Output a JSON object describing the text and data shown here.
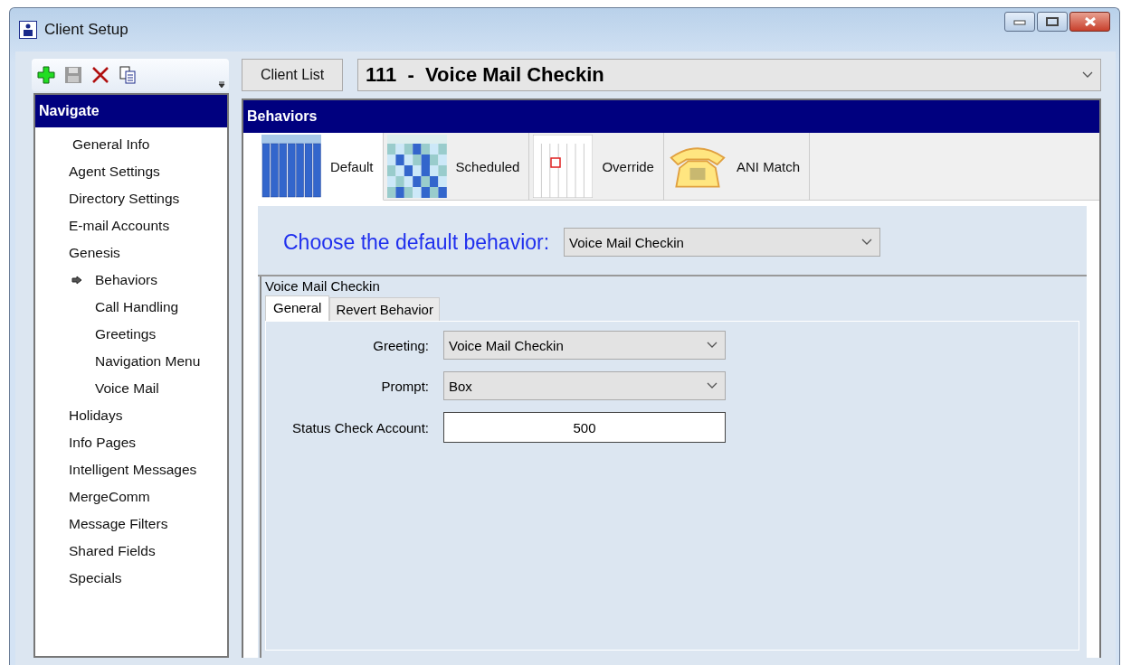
{
  "window": {
    "title": "Client Setup"
  },
  "client_list_button": "Client List",
  "client_selector": {
    "number": "111",
    "separator": "-",
    "name": "Voice Mail Checkin"
  },
  "navigate": {
    "title": "Navigate",
    "items": [
      {
        "label": "General Info"
      },
      {
        "label": "Agent Settings"
      },
      {
        "label": "Directory Settings"
      },
      {
        "label": "E-mail Accounts"
      },
      {
        "label": "Genesis",
        "children": [
          {
            "label": "Behaviors",
            "selected": true
          },
          {
            "label": "Call Handling",
            "selected": false
          },
          {
            "label": "Greetings",
            "selected": false
          },
          {
            "label": "Navigation Menu",
            "selected": false
          },
          {
            "label": "Voice Mail",
            "selected": false
          }
        ]
      },
      {
        "label": "Holidays"
      },
      {
        "label": "Info Pages"
      },
      {
        "label": "Intelligent Messages"
      },
      {
        "label": "MergeComm"
      },
      {
        "label": "Message Filters"
      },
      {
        "label": "Shared Fields"
      },
      {
        "label": "Specials"
      }
    ]
  },
  "behaviors": {
    "title": "Behaviors",
    "tabs": [
      {
        "label": "Default",
        "kind": "default",
        "selected": true
      },
      {
        "label": "Scheduled",
        "kind": "scheduled",
        "selected": false
      },
      {
        "label": "Override",
        "kind": "override",
        "selected": false
      },
      {
        "label": "ANI Match",
        "kind": "phone",
        "selected": false
      }
    ],
    "choose_label": "Choose the default behavior:",
    "choose_value": "Voice Mail Checkin",
    "group_title": "Voice Mail Checkin",
    "subtabs": [
      {
        "label": "General",
        "selected": true
      },
      {
        "label": "Revert Behavior",
        "selected": false
      }
    ],
    "fields": [
      {
        "label": "Greeting:",
        "kind": "dropdown",
        "value": "Voice Mail Checkin"
      },
      {
        "label": "Prompt:",
        "kind": "dropdown",
        "value": "Box"
      },
      {
        "label": "Status Check Account:",
        "kind": "text",
        "value": "500"
      }
    ]
  }
}
